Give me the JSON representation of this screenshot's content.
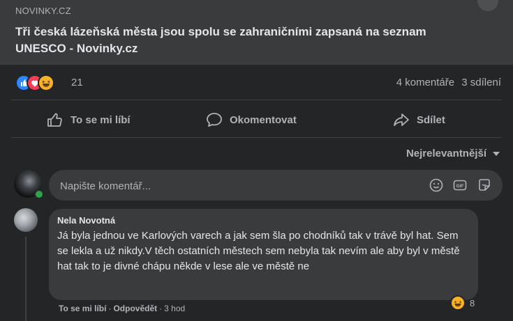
{
  "link_preview": {
    "source": "NOVINKY.CZ",
    "title": "Tři česká lázeňská města jsou spolu se zahraničními zapsaná na seznam UNESCO - Novinky.cz"
  },
  "reactions": {
    "icons": [
      "like-icon",
      "love-icon",
      "haha-icon"
    ],
    "count": "21"
  },
  "stats": {
    "comments": "4 komentáře",
    "shares": "3 sdílení"
  },
  "actions": {
    "like": "To se mi líbí",
    "comment": "Okomentovat",
    "share": "Sdílet"
  },
  "sort": {
    "label": "Nejrelevantnější"
  },
  "comment_input": {
    "placeholder": "Napište komentář..."
  },
  "comment": {
    "author": "Nela Novotná",
    "text": "Já byla jednou ve Karlových varech a jak sem šla po chodníků tak v trávě byl hat. Sem se lekla a už nikdy.V těch ostatních městech sem nebyla tak nevím ale aby byl v městě hat tak to je divné chápu někde v lese ale ve městě ne",
    "like": "To se mi líbí",
    "reply": "Odpovědět",
    "time": "3 hod",
    "reaction_count": "8"
  },
  "colors": {
    "background": "#18191a",
    "card": "#242526",
    "bubble": "#3a3b3c",
    "text": "#e4e6eb",
    "secondary": "#b0b3b8",
    "like_blue": "#2d88ff",
    "love_red": "#f33e58",
    "haha_yellow": "#f7b125",
    "online_green": "#31a24c"
  }
}
